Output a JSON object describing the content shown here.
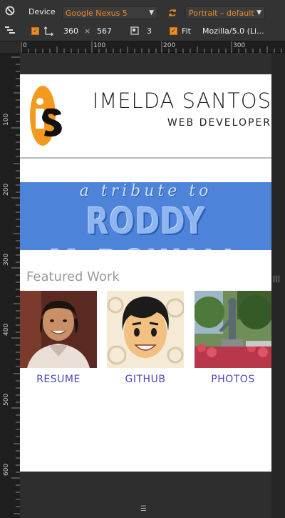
{
  "toolbar": {
    "device_label": "Device",
    "device_value": "Google Nexus 5",
    "orientation_value": "Portrait – default",
    "width_value": "360",
    "times_sign": "×",
    "height_value": "567",
    "dpr_value": "3",
    "fit_label": "Fit",
    "ua_value": "Mozilla/5.0 (Li..."
  },
  "ruler_top": [
    "0",
    "100",
    "200",
    "300"
  ],
  "ruler_left": [
    "100",
    "200",
    "300",
    "400",
    "500",
    "600"
  ],
  "page": {
    "name": "IMELDA  SANTOS",
    "role": "WEB  DEVELOPER",
    "banner_top": "a tribute to",
    "banner_main": "RODDY McDOWALL",
    "featured_heading": "Featured Work",
    "cards": [
      {
        "label": "RESUME"
      },
      {
        "label": "GITHUB"
      },
      {
        "label": "PHOTOS"
      }
    ]
  },
  "colors": {
    "accent_orange": "#f08a24",
    "banner_blue": "#4d83d8",
    "link_blue": "#4b48b8"
  }
}
